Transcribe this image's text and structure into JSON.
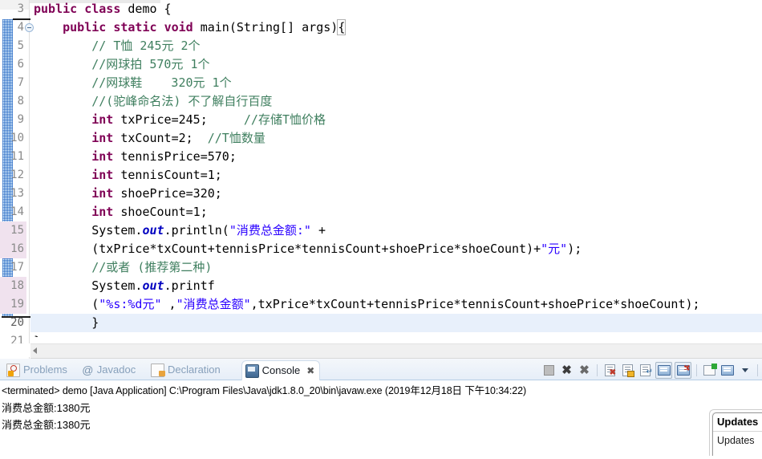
{
  "editor": {
    "first_visible_line": 3,
    "current_line": 20,
    "marked_lines": [
      15,
      16,
      18,
      19
    ],
    "lines": [
      {
        "num": "3",
        "indent": 0,
        "fold": false,
        "tokens": [
          {
            "t": "public",
            "c": "kw"
          },
          {
            "t": " ",
            "c": "pln"
          },
          {
            "t": "class",
            "c": "kw"
          },
          {
            "t": " demo {",
            "c": "pln"
          }
        ]
      },
      {
        "num": "4",
        "indent": 0,
        "fold": true,
        "tokens": [
          {
            "t": "    ",
            "c": "pln"
          },
          {
            "t": "public",
            "c": "kw"
          },
          {
            "t": " ",
            "c": "pln"
          },
          {
            "t": "static",
            "c": "kw"
          },
          {
            "t": " ",
            "c": "pln"
          },
          {
            "t": "void",
            "c": "kw"
          },
          {
            "t": " main(String[] args)",
            "c": "pln"
          },
          {
            "t": "{",
            "c": "brace"
          }
        ]
      },
      {
        "num": "5",
        "indent": 0,
        "fold": false,
        "tokens": [
          {
            "t": "        // T恤 245元 2个",
            "c": "cmt"
          }
        ]
      },
      {
        "num": "6",
        "indent": 0,
        "fold": false,
        "tokens": [
          {
            "t": "        //网球拍 570元 1个",
            "c": "cmt"
          }
        ]
      },
      {
        "num": "7",
        "indent": 0,
        "fold": false,
        "tokens": [
          {
            "t": "        //网球鞋    320元 1个",
            "c": "cmt"
          }
        ]
      },
      {
        "num": "8",
        "indent": 0,
        "fold": false,
        "tokens": [
          {
            "t": "        //(驼峰命名法) 不了解自行百度",
            "c": "cmt"
          }
        ]
      },
      {
        "num": "9",
        "indent": 0,
        "fold": false,
        "tokens": [
          {
            "t": "        ",
            "c": "pln"
          },
          {
            "t": "int",
            "c": "kw"
          },
          {
            "t": " txPrice=245;",
            "c": "pln"
          },
          {
            "t": "     //存储T恤价格",
            "c": "cmt"
          }
        ]
      },
      {
        "num": "10",
        "indent": 0,
        "fold": false,
        "tokens": [
          {
            "t": "        ",
            "c": "pln"
          },
          {
            "t": "int",
            "c": "kw"
          },
          {
            "t": " txCount=2;",
            "c": "pln"
          },
          {
            "t": "  //T恤数量",
            "c": "cmt"
          }
        ]
      },
      {
        "num": "11",
        "indent": 0,
        "fold": false,
        "tokens": [
          {
            "t": "        ",
            "c": "pln"
          },
          {
            "t": "int",
            "c": "kw"
          },
          {
            "t": " tennisPrice=570;",
            "c": "pln"
          }
        ]
      },
      {
        "num": "12",
        "indent": 0,
        "fold": false,
        "tokens": [
          {
            "t": "        ",
            "c": "pln"
          },
          {
            "t": "int",
            "c": "kw"
          },
          {
            "t": " tennisCount=1;",
            "c": "pln"
          }
        ]
      },
      {
        "num": "13",
        "indent": 0,
        "fold": false,
        "tokens": [
          {
            "t": "        ",
            "c": "pln"
          },
          {
            "t": "int",
            "c": "kw"
          },
          {
            "t": " shoePrice=320;",
            "c": "pln"
          }
        ]
      },
      {
        "num": "14",
        "indent": 0,
        "fold": false,
        "tokens": [
          {
            "t": "        ",
            "c": "pln"
          },
          {
            "t": "int",
            "c": "kw"
          },
          {
            "t": " shoeCount=1;",
            "c": "pln"
          }
        ]
      },
      {
        "num": "15",
        "indent": 0,
        "fold": false,
        "tokens": [
          {
            "t": "        System.",
            "c": "pln"
          },
          {
            "t": "out",
            "c": "stat"
          },
          {
            "t": ".println(",
            "c": "pln"
          },
          {
            "t": "\"消费总金额:\"",
            "c": "str"
          },
          {
            "t": " +",
            "c": "pln"
          }
        ]
      },
      {
        "num": "16",
        "indent": 0,
        "fold": false,
        "tokens": [
          {
            "t": "        (txPrice*txCount+tennisPrice*tennisCount+shoePrice*shoeCount)+",
            "c": "pln"
          },
          {
            "t": "\"元\"",
            "c": "str"
          },
          {
            "t": ");",
            "c": "pln"
          }
        ]
      },
      {
        "num": "17",
        "indent": 0,
        "fold": false,
        "tokens": [
          {
            "t": "        //或者 (推荐第二种)",
            "c": "cmt"
          }
        ]
      },
      {
        "num": "18",
        "indent": 0,
        "fold": false,
        "tokens": [
          {
            "t": "        System.",
            "c": "pln"
          },
          {
            "t": "out",
            "c": "stat"
          },
          {
            "t": ".printf",
            "c": "pln"
          }
        ]
      },
      {
        "num": "19",
        "indent": 0,
        "fold": false,
        "tokens": [
          {
            "t": "        (",
            "c": "pln"
          },
          {
            "t": "\"%s:%d元\"",
            "c": "str"
          },
          {
            "t": " ,",
            "c": "pln"
          },
          {
            "t": "\"消费总金额\"",
            "c": "str"
          },
          {
            "t": ",txPrice*txCount+tennisPrice*tennisCount+shoePrice*shoeCount);",
            "c": "pln"
          }
        ]
      },
      {
        "num": "20",
        "indent": 0,
        "fold": false,
        "current": true,
        "tokens": [
          {
            "t": "        }",
            "c": "pln"
          }
        ]
      },
      {
        "num": "21",
        "indent": 0,
        "fold": false,
        "tokens": [
          {
            "t": "}",
            "c": "pln"
          }
        ]
      }
    ]
  },
  "bottom_view": {
    "tabs": [
      {
        "label": "Problems",
        "icon": "problems-icon",
        "active": false
      },
      {
        "label": "Javadoc",
        "icon": "javadoc-icon",
        "active": false
      },
      {
        "label": "Declaration",
        "icon": "declaration-icon",
        "active": false
      },
      {
        "label": "Console",
        "icon": "console-icon",
        "active": true,
        "close_glyph": "✖"
      }
    ],
    "toolbar": [
      {
        "name": "terminate-button",
        "title": "Terminate"
      },
      {
        "name": "remove-launch-button",
        "title": "Remove Launch"
      },
      {
        "name": "remove-all-terminated-button",
        "title": "Remove All Terminated Launches"
      },
      {
        "name": "clear-console-button",
        "title": "Clear Console"
      },
      {
        "name": "scroll-lock-button",
        "title": "Scroll Lock"
      },
      {
        "name": "word-wrap-button",
        "title": "Word Wrap"
      },
      {
        "name": "show-console-on-output-button",
        "title": "Show Console When Standard Out Changes",
        "pressed": true
      },
      {
        "name": "show-console-on-error-button",
        "title": "Show Console When Standard Error Changes",
        "pressed": true
      },
      {
        "name": "open-console-button",
        "title": "Open Console"
      },
      {
        "name": "display-selected-console-button",
        "title": "Display Selected Console"
      },
      {
        "name": "console-menu-dropdown",
        "title": "Menu"
      }
    ],
    "console": {
      "header": "<terminated> demo [Java Application] C:\\Program Files\\Java\\jdk1.8.0_20\\bin\\javaw.exe (2019年12月18日 下午10:34:22)",
      "output": [
        "消费总金额:1380元",
        "消费总金额:1380元"
      ]
    }
  },
  "popup": {
    "title": "Updates ",
    "body_line": "Updates"
  },
  "colors": {
    "keyword": "#7f0055",
    "string": "#2a00ff",
    "comment": "#3f7f5f",
    "static_field": "#0000c0",
    "current_line": "#e8f0fb",
    "gutter_mark": "#f0e2ee",
    "change_bar": "#4a90d9",
    "tab_active_text": "#13181f",
    "tab_inactive_text": "#87a0bb"
  }
}
